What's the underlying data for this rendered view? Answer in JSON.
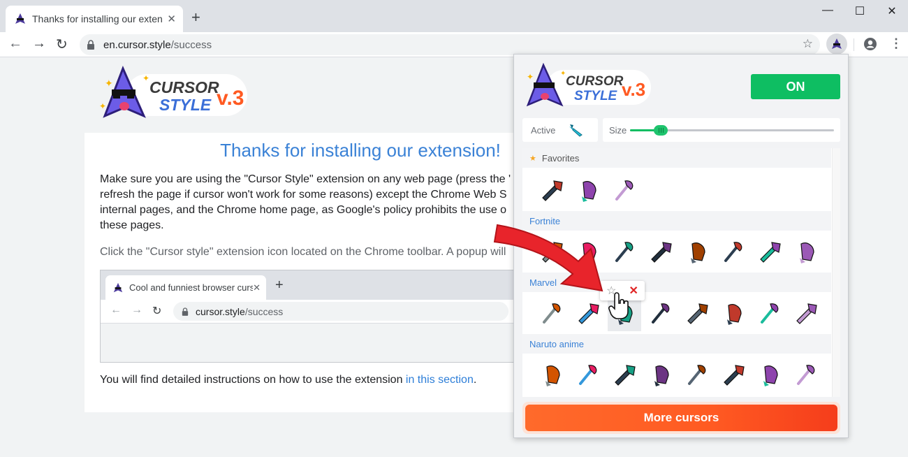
{
  "browser": {
    "tab_title": "Thanks for installing our extensio",
    "tab_close": "✕",
    "new_tab": "+",
    "window_controls": {
      "minimize": "—",
      "maximize": "☐",
      "close": "✕"
    },
    "url_host": "en.cursor.style",
    "url_path": "/success"
  },
  "page": {
    "logo": {
      "line1": "CURSOR",
      "line2": "STYLE",
      "version": "v.3"
    },
    "heading": "Thanks for installing our extension!",
    "paragraph_lines": [
      "Make sure you are using the \"Cursor Style\" extension on any web page (press the '",
      "refresh the page if cursor won't work for some reasons) except the Chrome Web S",
      "internal pages, and the Chrome home page, as Google's policy prohibits the use o",
      "these pages."
    ],
    "click_text": "Click the \"Cursor style\" extension icon located on the Chrome toolbar. A popup will",
    "mini_browser": {
      "tab_title": "Cool and funniest browser curs",
      "url_host": "cursor.style",
      "url_path": "/success"
    },
    "instructions_prefix": "You will find detailed instructions on how to use the extension ",
    "instructions_link": "in this section",
    "instructions_suffix": "."
  },
  "popup": {
    "logo": {
      "line1": "CURSOR",
      "line2": "STYLE",
      "version": "v.3"
    },
    "toggle_label": "ON",
    "active_label": "Active",
    "size_label": "Size",
    "size_level": 0.15,
    "categories": [
      {
        "name": "Favorites",
        "count": 3
      },
      {
        "name": "Fortnite",
        "count": 8
      },
      {
        "name": "Marvel",
        "count": 8
      },
      {
        "name": "Naruto anime",
        "count": 8
      }
    ],
    "more_button": "More cursors"
  },
  "colors": {
    "accent_blue": "#3b82d6",
    "on_green": "#0ebe62",
    "more_orange": "#ff5a22",
    "arrow_red": "#e8242b"
  }
}
